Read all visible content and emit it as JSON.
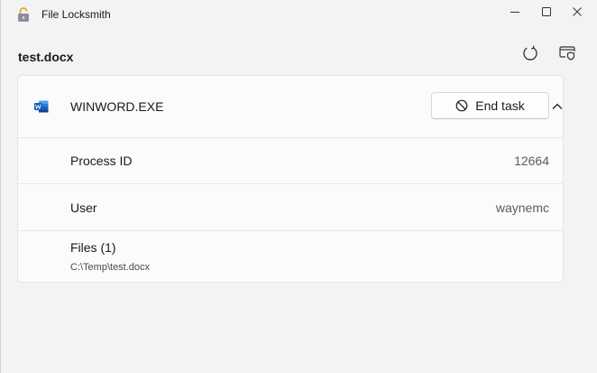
{
  "window": {
    "title": "File Locksmith"
  },
  "header": {
    "file_name": "test.docx"
  },
  "process": {
    "name": "WINWORD.EXE",
    "end_task_label": "End task",
    "pid_label": "Process ID",
    "pid_value": "12664",
    "user_label": "User",
    "user_value": "waynemc",
    "files_label": "Files (1)",
    "files": [
      "C:\\Temp\\test.docx"
    ]
  },
  "icons": {
    "app": "padlock-open-icon",
    "minimize": "minimize-icon",
    "maximize": "maximize-icon",
    "close": "close-icon",
    "refresh": "refresh-icon",
    "admin": "shield-window-icon",
    "process": "word-icon",
    "end_task": "block-icon",
    "collapse": "chevron-up-icon"
  },
  "colors": {
    "background": "#f3f3f3",
    "card": "#fbfbfb",
    "word_blue": "#185abd",
    "lock_gold": "#e8a23a"
  }
}
